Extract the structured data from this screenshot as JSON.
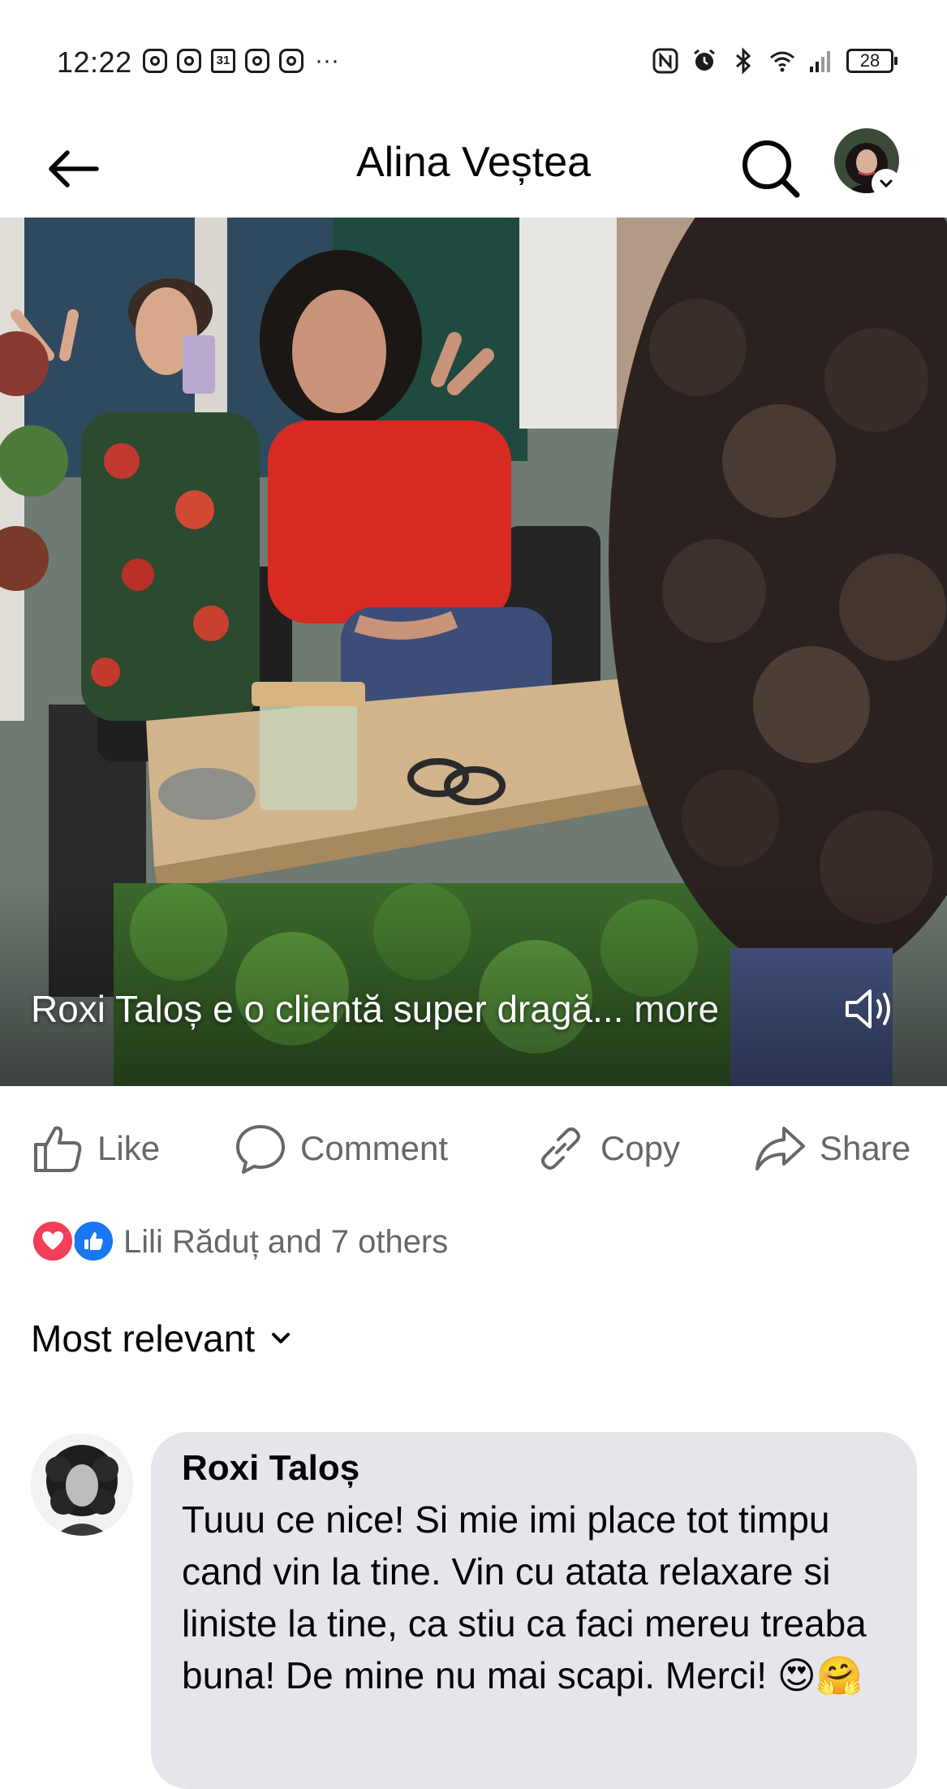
{
  "status_bar": {
    "time": "12:22",
    "calendar_day": "31",
    "overflow_dots": "···",
    "battery": "28",
    "notification_icons": [
      "instagram-icon",
      "instagram-icon",
      "calendar-icon",
      "instagram-icon",
      "instagram-icon"
    ],
    "system_icons": [
      "nfc-icon",
      "alarm-icon",
      "bluetooth-icon",
      "wifi-icon",
      "signal-icon"
    ]
  },
  "header": {
    "title": "Alina Veștea",
    "back_icon": "arrow-left-icon",
    "search_icon": "search-icon"
  },
  "video": {
    "caption": "Roxi Taloș e o clientă super dragă...",
    "more_label": "more",
    "volume_icon": "speaker-icon"
  },
  "actions": {
    "like": "Like",
    "comment": "Comment",
    "copy": "Copy",
    "share": "Share"
  },
  "reactions": {
    "text": "Lili Răduț and 7 others",
    "types": [
      "love",
      "like"
    ]
  },
  "sort": {
    "label": "Most relevant"
  },
  "comments": [
    {
      "author": "Roxi Taloș",
      "text": "Tuuu ce nice! Si mie imi place tot timpu cand vin la tine. Vin cu atata relaxare si liniste la tine, ca stiu ca faci mereu treaba buna! De mine nu mai scapi. Merci! 😍🤗"
    }
  ],
  "colors": {
    "text_primary": "#050505",
    "text_secondary": "#65676b",
    "bubble_bg": "#e4e6eb",
    "love_red": "#f33e58",
    "like_blue": "#1877f2"
  }
}
